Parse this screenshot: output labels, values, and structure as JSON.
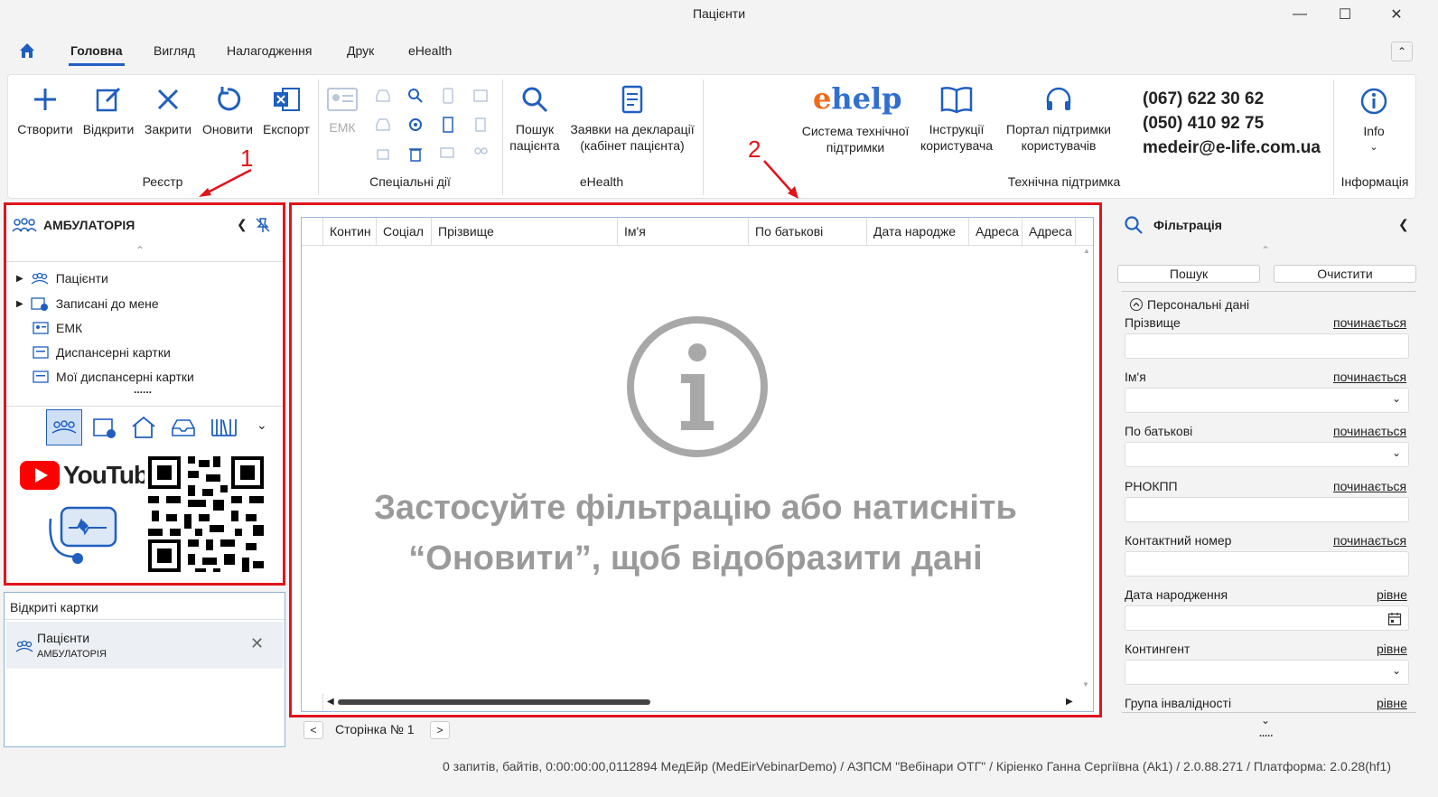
{
  "window": {
    "title": "Пацієнти"
  },
  "tabs": [
    "Головна",
    "Вигляд",
    "Налагодження",
    "Друк",
    "eHealth"
  ],
  "ribbon": {
    "registry": {
      "create": "Створити",
      "open": "Відкрити",
      "close": "Закрити",
      "refresh": "Оновити",
      "export": "Експорт",
      "group": "Реєстр"
    },
    "special": {
      "emk": "ЕМК",
      "group": "Спеціальні дії"
    },
    "ehealth": {
      "search_l1": "Пошук",
      "search_l2": "пацієнта",
      "decl_l1": "Заявки на декларації",
      "decl_l2": "(кабінет пацієнта)",
      "group": "eHealth"
    },
    "support": {
      "ehelp_logo": "ehelp",
      "system_l1": "Система технічної",
      "system_l2": "підтримки",
      "instr_l1": "Інструкції",
      "instr_l2": "користувача",
      "portal_l1": "Портал підтримки",
      "portal_l2": "користувачів",
      "phone1": "(067) 622 30 62",
      "phone2": "(050) 410 92 75",
      "email": "medeir@e-life.com.ua",
      "group": "Технічна підтримка"
    },
    "info": {
      "label": "Info",
      "group": "Інформація"
    }
  },
  "annotations": {
    "one": "1",
    "two": "2"
  },
  "left_panel": {
    "title": "АМБУЛАТОРІЯ",
    "items": [
      "Пацієнти",
      "Записані до мене",
      "ЕМК",
      "Диспансерні картки",
      "Мої диспансерні картки"
    ],
    "more": "......",
    "youtube": "YouTube"
  },
  "open_cards": {
    "title": "Відкриті картки",
    "card_title": "Пацієнти",
    "card_sub": "АМБУЛАТОРІЯ"
  },
  "grid": {
    "columns": [
      "Контин",
      "Соціал",
      "Прізвище",
      "Ім'я",
      "По батькові",
      "Дата народже",
      "Адреса",
      "Адреса"
    ],
    "empty_l1": "Застосуйте фільтрацію або натисніть",
    "empty_l2": "“Оновити”, щоб відобразити дані",
    "page": "Сторінка № 1",
    "prev": "<",
    "next": ">"
  },
  "filter": {
    "title": "Фільтрація",
    "search_btn": "Пошук",
    "clear_btn": "Очистити",
    "section": "Персональні дані",
    "fields": [
      {
        "label": "Прізвище",
        "op": "починається"
      },
      {
        "label": "Ім'я",
        "op": "починається"
      },
      {
        "label": "По батькові",
        "op": "починається"
      },
      {
        "label": "РНОКПП",
        "op": "починається"
      },
      {
        "label": "Контактний номер",
        "op": "починається"
      },
      {
        "label": "Дата народження",
        "op": "рівне"
      },
      {
        "label": "Контингент",
        "op": "рівне"
      },
      {
        "label": "Група інвалідності",
        "op": "рівне"
      }
    ],
    "more": "....."
  },
  "status": "0 запитів,  байтів, 0:00:00:00,0112894  МедЕйр (MedEirVebinarDemo) / АЗПСМ \"Вебінари ОТГ\" / Кіріенко Ганна Сергіївна (Ak1) / 2.0.88.271 / Платформа: 2.0.28(hf1)",
  "colors": {
    "accent": "#1f5fbf",
    "annotation_red": "#e1141c"
  }
}
